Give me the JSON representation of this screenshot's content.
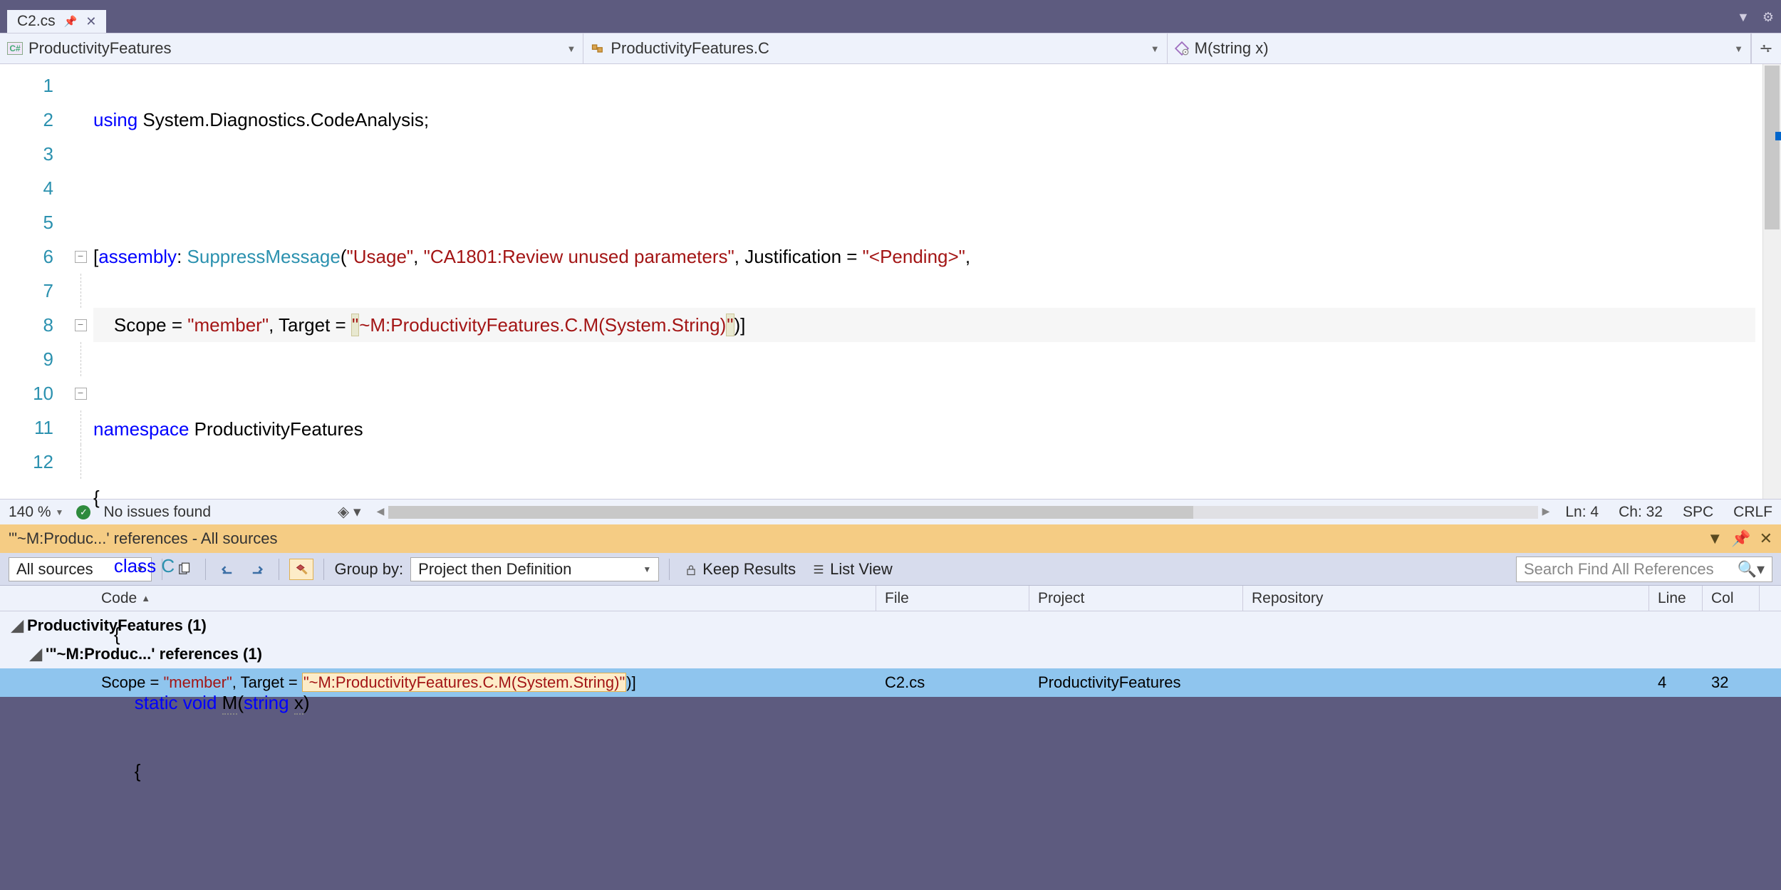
{
  "tab": {
    "filename": "C2.cs"
  },
  "nav": {
    "namespace": "ProductivityFeatures",
    "class": "ProductivityFeatures.C",
    "member": "M(string x)"
  },
  "code": {
    "lines": [
      "1",
      "2",
      "3",
      "4",
      "5",
      "6",
      "7",
      "8",
      "9",
      "10",
      "11",
      "12"
    ],
    "l1_using": "using",
    "l1_rest": " System.Diagnostics.CodeAnalysis;",
    "l3_open": "[",
    "l3_assembly": "assembly",
    "l3_colon": ": ",
    "l3_supp": "SuppressMessage",
    "l3_p1": "(",
    "l3_s1": "\"Usage\"",
    "l3_c1": ", ",
    "l3_s2": "\"CA1801:Review unused parameters\"",
    "l3_c2": ", Justification = ",
    "l3_s3": "\"<Pending>\"",
    "l3_end": ",",
    "l4_pre": "    Scope = ",
    "l4_s1": "\"member\"",
    "l4_c1": ", Target = ",
    "l4_s2a": "\"",
    "l4_s2b": "~M:ProductivityFeatures.C.M(System.String)",
    "l4_s2c": "\"",
    "l4_end": ")]",
    "l6_ns": "namespace",
    "l6_rest": " ProductivityFeatures",
    "l7": "{",
    "l8_pre": "    ",
    "l8_class": "class",
    "l8_rest": " ",
    "l8_C": "C",
    "l9": "    {",
    "l10_pre": "        ",
    "l10_static": "static",
    "l10_sp": " ",
    "l10_void": "void",
    "l10_sp2": " ",
    "l10_M": "M",
    "l10_p1": "(",
    "l10_string": "string",
    "l10_sp3": " ",
    "l10_x": "x",
    "l10_p2": ")",
    "l11": "        {",
    "l12": ""
  },
  "status": {
    "zoom": "140 %",
    "issues": "No issues found",
    "ln": "Ln: 4",
    "ch": "Ch: 32",
    "spc": "SPC",
    "crlf": "CRLF"
  },
  "refpanel": {
    "title": "'\"~M:Produc...' references - All sources",
    "source_combo": "All sources",
    "groupby_label": "Group by:",
    "groupby_value": "Project then Definition",
    "keep": "Keep Results",
    "listview": "List View",
    "search_placeholder": "Search Find All References"
  },
  "rescols": {
    "code": "Code",
    "file": "File",
    "project": "Project",
    "repo": "Repository",
    "line": "Line",
    "col": "Col"
  },
  "results": {
    "group1": "ProductivityFeatures  (1)",
    "group2": "'\"~M:Produc...' references  (1)",
    "row": {
      "pre": "Scope = ",
      "s1": "\"member\"",
      "mid": ", Target = ",
      "s2": "\"~M:ProductivityFeatures.C.M(System.String)\"",
      "end": ")]",
      "file": "C2.cs",
      "project": "ProductivityFeatures",
      "line": "4",
      "col": "32"
    }
  }
}
